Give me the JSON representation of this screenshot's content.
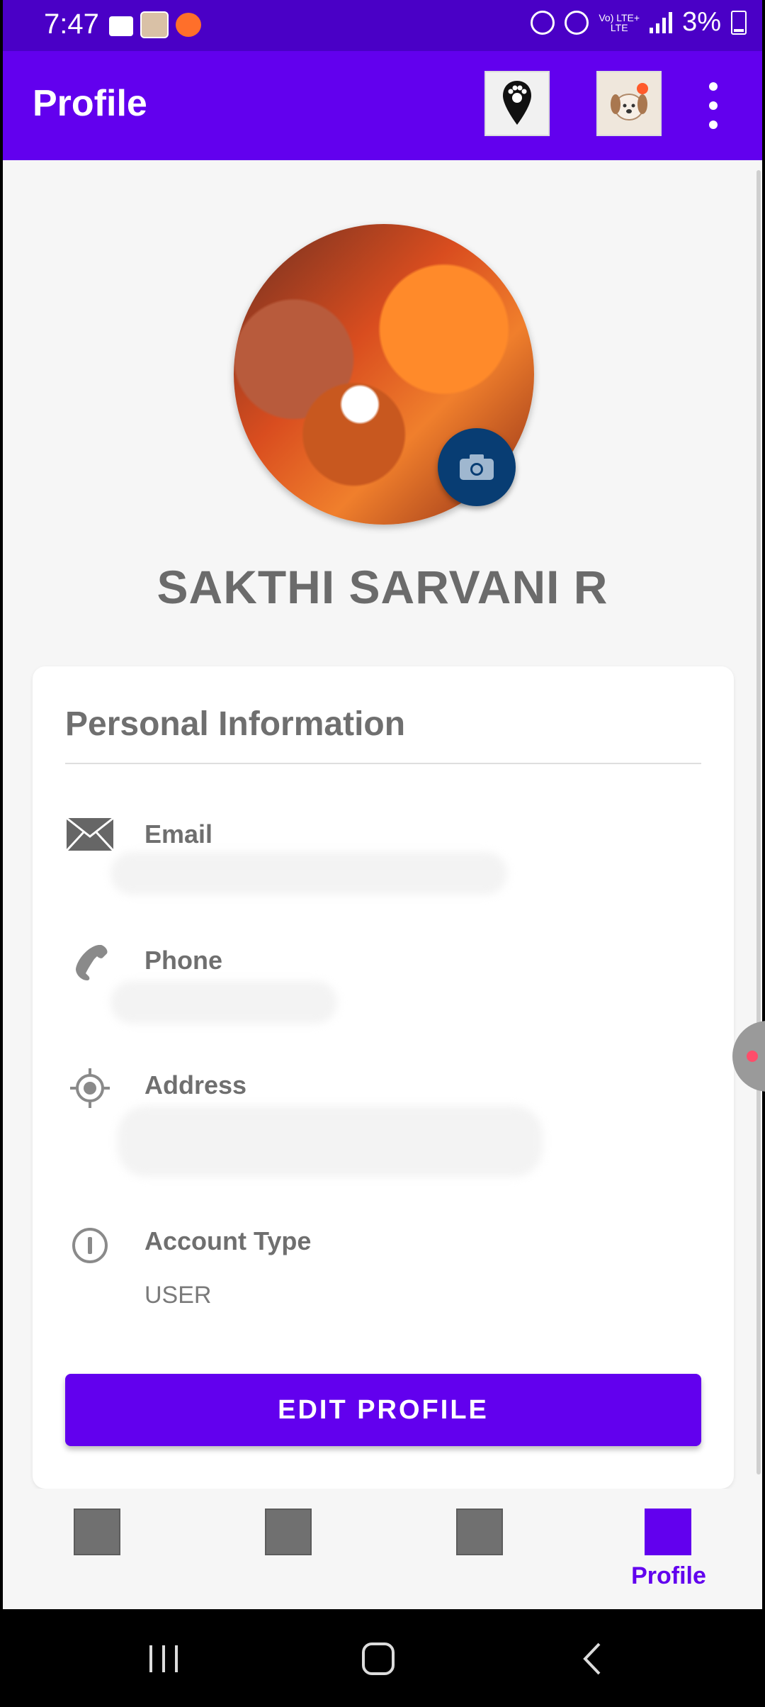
{
  "status_bar": {
    "time": "7:47",
    "battery_percent": "3%",
    "lte_top": "Vo) LTE+",
    "lte_bottom": "LTE"
  },
  "app_bar": {
    "title": "Profile"
  },
  "profile": {
    "name": "SAKTHI SARVANI R"
  },
  "card": {
    "title": "Personal Information",
    "fields": [
      {
        "label": "Email",
        "icon": "mail-icon"
      },
      {
        "label": "Phone",
        "icon": "phone-icon"
      },
      {
        "label": "Address",
        "icon": "location-icon"
      },
      {
        "label": "Account Type",
        "icon": "info-icon",
        "value": "USER"
      }
    ],
    "edit_button": "EDIT PROFILE"
  },
  "bottom_nav": {
    "active_label": "Profile"
  },
  "colors": {
    "primary": "#6200ee",
    "status_bar": "#4a00c6",
    "camera_button": "#083d73"
  }
}
